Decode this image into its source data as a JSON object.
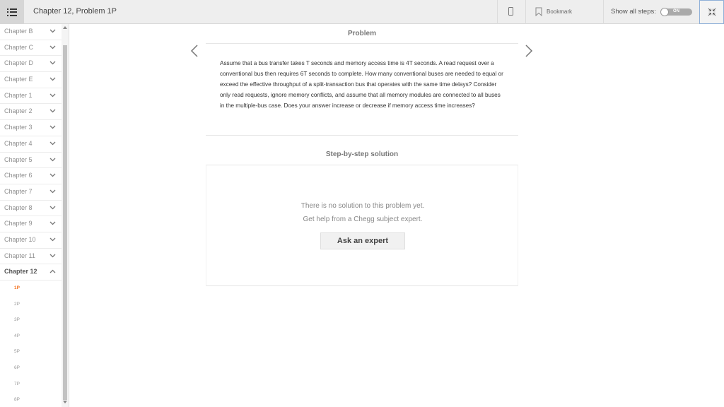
{
  "header": {
    "title": "Chapter 12, Problem 1P",
    "bookmark_label": "Bookmark",
    "show_steps_label": "Show all steps:",
    "toggle_label": "ON"
  },
  "sidebar": {
    "chapters": [
      {
        "label": "Chapter B"
      },
      {
        "label": "Chapter C"
      },
      {
        "label": "Chapter D"
      },
      {
        "label": "Chapter E"
      },
      {
        "label": "Chapter 1"
      },
      {
        "label": "Chapter 2"
      },
      {
        "label": "Chapter 3"
      },
      {
        "label": "Chapter 4"
      },
      {
        "label": "Chapter 5"
      },
      {
        "label": "Chapter 6"
      },
      {
        "label": "Chapter 7"
      },
      {
        "label": "Chapter 8"
      },
      {
        "label": "Chapter 9"
      },
      {
        "label": "Chapter 10"
      },
      {
        "label": "Chapter 11"
      },
      {
        "label": "Chapter 12"
      }
    ],
    "active_chapter": "Chapter 12",
    "problems": [
      {
        "label": "1P"
      },
      {
        "label": "2P"
      },
      {
        "label": "3P"
      },
      {
        "label": "4P"
      },
      {
        "label": "5P"
      },
      {
        "label": "6P"
      },
      {
        "label": "7P"
      },
      {
        "label": "8P"
      }
    ],
    "active_problem": "1P"
  },
  "problem": {
    "heading": "Problem",
    "text": "Assume that a bus transfer takes T seconds and memory access time is 4T seconds. A read request over a conventional bus then requires 6T seconds to complete. How many conventional buses are needed to equal or exceed the effective throughput of a split-transaction bus that operates with the same time delays? Consider only read requests, ignore memory conflicts, and assume that all memory modules are connected to all buses in the multiple-bus case. Does your answer increase or decrease if memory access time increases?"
  },
  "solution": {
    "heading": "Step-by-step solution",
    "no_solution_text": "There is no solution to this problem yet.",
    "help_text": "Get help from a Chegg subject expert.",
    "ask_button_label": "Ask an expert"
  },
  "colors": {
    "accent": "#f47321",
    "topbar_bg": "#eeeeee",
    "collapse_border": "#8fb0d8"
  }
}
